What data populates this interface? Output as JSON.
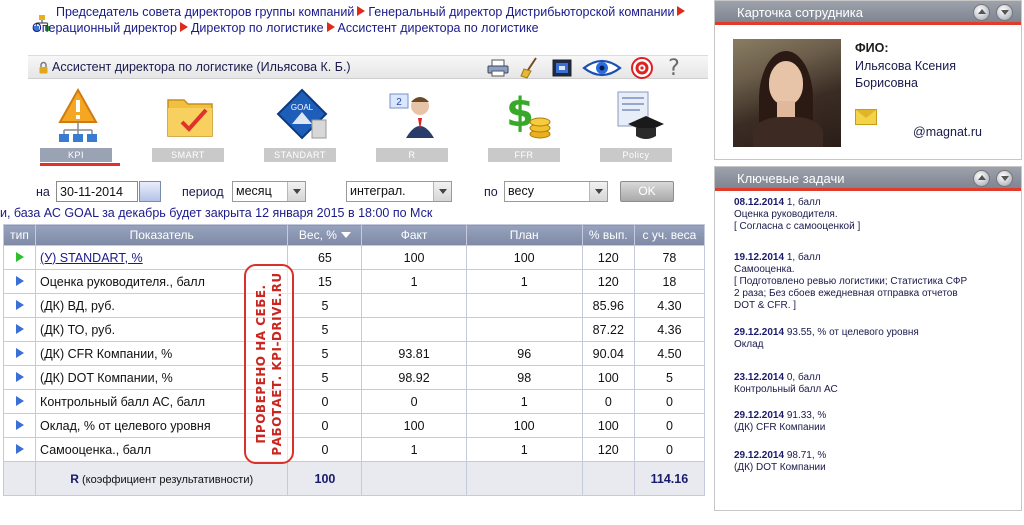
{
  "breadcrumb": {
    "items": [
      "Председатель совета директоров группы компаний",
      "Генеральный директор Дистрибьюторской компании",
      "Операционный директор",
      "Директор по логистике",
      "Ассистент директора по логистике"
    ]
  },
  "user_bar": {
    "title": "Ассистент директора по логистике  (Ильясова К. Б.)",
    "icons": [
      "printer-icon",
      "broom-icon",
      "export-icon",
      "eye-icon",
      "target-icon",
      "help-icon"
    ],
    "help_glyph": "?"
  },
  "modules": [
    {
      "label": "KPI",
      "icon": "warning-tree-icon",
      "active": true
    },
    {
      "label": "SMART",
      "icon": "folder-check-icon",
      "active": false
    },
    {
      "label": "STANDART",
      "icon": "goal-badge-icon",
      "active": false
    },
    {
      "label": "R",
      "icon": "person-numbers-icon",
      "active": false
    },
    {
      "label": "FFR",
      "icon": "money-icon",
      "active": false
    },
    {
      "label": "Policy",
      "icon": "scroll-graduation-icon",
      "active": false
    }
  ],
  "filters": {
    "date_label": "на",
    "date_value": "30-11-2014",
    "period_label": "период",
    "period_value": "месяц",
    "mode_value": "интеграл.",
    "by_label": "по",
    "by_value": "весу",
    "ok_label": "OK"
  },
  "notice": "и, база АС GOAL за декабрь будет закрыта 12 января 2015 в 18:00 по Мск",
  "table": {
    "headers": {
      "type": "тип",
      "indicator": "Показатель",
      "weight": "Вес, %",
      "fact": "Факт",
      "plan": "План",
      "pct": "% вып.",
      "weighted": "с уч. веса"
    },
    "rows": [
      {
        "name": "(У) STANDART, %",
        "link": true,
        "green": true,
        "weight": "65",
        "fact": "100",
        "plan": "100",
        "pct": "120",
        "weighted": "78"
      },
      {
        "name": "Оценка руководителя., балл",
        "link": false,
        "green": false,
        "weight": "15",
        "fact": "1",
        "plan": "1",
        "pct": "120",
        "weighted": "18"
      },
      {
        "name": "(ДК) ВД, руб.",
        "link": false,
        "green": false,
        "weight": "5",
        "fact": "",
        "plan": "",
        "pct": "85.96",
        "weighted": "4.30"
      },
      {
        "name": "(ДК) ТО, руб.",
        "link": false,
        "green": false,
        "weight": "5",
        "fact": "",
        "plan": "",
        "pct": "87.22",
        "weighted": "4.36"
      },
      {
        "name": "(ДК) CFR Компании, %",
        "link": false,
        "green": false,
        "weight": "5",
        "fact": "93.81",
        "plan": "96",
        "pct": "90.04",
        "weighted": "4.50"
      },
      {
        "name": "(ДК) DOT Компании, %",
        "link": false,
        "green": false,
        "weight": "5",
        "fact": "98.92",
        "plan": "98",
        "pct": "100",
        "weighted": "5"
      },
      {
        "name": "Контрольный балл АС, балл",
        "link": false,
        "green": false,
        "weight": "0",
        "fact": "0",
        "plan": "1",
        "pct": "0",
        "weighted": "0"
      },
      {
        "name": "Оклад, % от целевого уровня",
        "link": false,
        "green": false,
        "weight": "0",
        "fact": "100",
        "plan": "100",
        "pct": "100",
        "weighted": "0"
      },
      {
        "name": "Самооценка., балл",
        "link": false,
        "green": false,
        "weight": "0",
        "fact": "1",
        "plan": "1",
        "pct": "120",
        "weighted": "0"
      }
    ],
    "summary": {
      "label_bold": "R",
      "label_rest": "(коэффициент результативности)",
      "weight_total": "100",
      "weighted_total": "114.16"
    }
  },
  "stamp": {
    "line1": "ПРОВЕРЕНО НА СЕБЕ.",
    "line2": "РАБОТАЕТ. KPI-DRIVE.RU"
  },
  "employee_card": {
    "header": "Карточка сотрудника",
    "fio_label": "ФИО:",
    "name_line1": "Ильясова Ксения",
    "name_line2": "Борисовна",
    "email": "@magnat.ru"
  },
  "key_tasks": {
    "header": "Ключевые задачи",
    "items": [
      {
        "date": "08.12.2014",
        "value": "1, балл",
        "lines": [
          "Оценка руководителя.",
          "[ Согласна с самооценкой ]"
        ]
      },
      {
        "date": "19.12.2014",
        "value": "1, балл",
        "lines": [
          "Самооценка.",
          "[ Подготовлено ревью логистики; Статистика СФР",
          "2 раза; Без сбоев ежедневная отправка отчетов",
          "DOT & CFR. ]"
        ]
      },
      {
        "date": "29.12.2014",
        "value": "93.55, % от целевого уровня",
        "lines": [
          "Оклад"
        ]
      },
      {
        "date": "23.12.2014",
        "value": "0, балл",
        "lines": [
          "Контрольный балл АС"
        ]
      },
      {
        "date": "29.12.2014",
        "value": "91.33, %",
        "lines": [
          "(ДК) CFR Компании"
        ]
      },
      {
        "date": "29.12.2014",
        "value": "98.71, %",
        "lines": [
          "(ДК) DOT Компании"
        ]
      }
    ]
  },
  "colors": {
    "accent_red": "#e0322a",
    "header_blue": "#8893ad",
    "text_navy": "#1a1a8c",
    "triangle_blue": "#3a6fd8",
    "triangle_green": "#2fbf2f"
  }
}
